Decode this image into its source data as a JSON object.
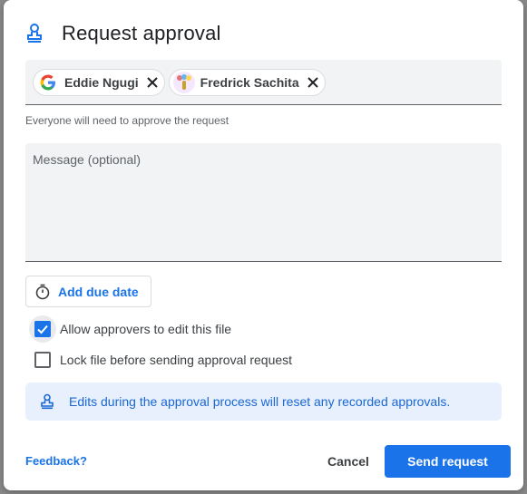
{
  "dialog": {
    "title": "Request approval",
    "title_icon": "approval-stamp-icon"
  },
  "recipients": [
    {
      "name": "Eddie Ngugi",
      "avatar": "google-g-icon"
    },
    {
      "name": "Fredrick Sachita",
      "avatar": "user-avatar-icon"
    }
  ],
  "helper_text": "Everyone will need to approve the request",
  "message": {
    "placeholder": "Message (optional)",
    "value": ""
  },
  "due_date": {
    "label": "Add due date",
    "icon": "timer-icon"
  },
  "options": [
    {
      "label": "Allow approvers to edit this file",
      "checked": true
    },
    {
      "label": "Lock file before sending approval request",
      "checked": false
    }
  ],
  "info": {
    "text": "Edits during the approval process will reset any recorded approvals.",
    "icon": "approval-stamp-icon"
  },
  "footer": {
    "feedback": "Feedback?",
    "cancel": "Cancel",
    "send": "Send request"
  },
  "colors": {
    "accent": "#1a73e8",
    "info_bg": "#e8f0fe",
    "field_bg": "#f1f3f4"
  }
}
